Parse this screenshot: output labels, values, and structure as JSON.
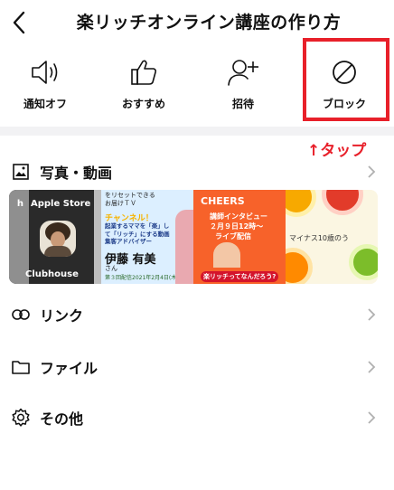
{
  "header": {
    "title": "楽リッチオンライン講座の作り方"
  },
  "actions": [
    {
      "label": "通知オフ",
      "icon": "speaker-icon"
    },
    {
      "label": "おすすめ",
      "icon": "thumbs-up-icon"
    },
    {
      "label": "招待",
      "icon": "add-user-icon"
    },
    {
      "label": "ブロック",
      "icon": "block-icon"
    }
  ],
  "annotation": {
    "tap_note": "↑タップ",
    "color": "#e8202a"
  },
  "media": {
    "label": "写真・動画",
    "thumbnails": [
      {
        "top_text": "Apple Store",
        "top_prefix": "h",
        "bottom_text": "Clubhouse"
      },
      {
        "top_lines": [
          "をリセットできる",
          "お届けＴＶ"
        ],
        "channel": "チャンネル！",
        "desc_lines": [
          "起業するママを「楽」し",
          "て「リッチ」にする動画",
          "集客アドバイザー"
        ],
        "name": "伊藤 有美",
        "honorific": "さん",
        "date": "第３回配信2021年2月4日(木)19"
      },
      {
        "title": "CHEERS",
        "lines": [
          "講師インタビュー",
          "２月９日12時～",
          "ライブ配信"
        ],
        "bottom": "楽リッチってなんだろう?"
      },
      {
        "text": "マイナス10歳のう"
      }
    ]
  },
  "rows": {
    "link": "リンク",
    "file": "ファイル",
    "other": "その他"
  }
}
